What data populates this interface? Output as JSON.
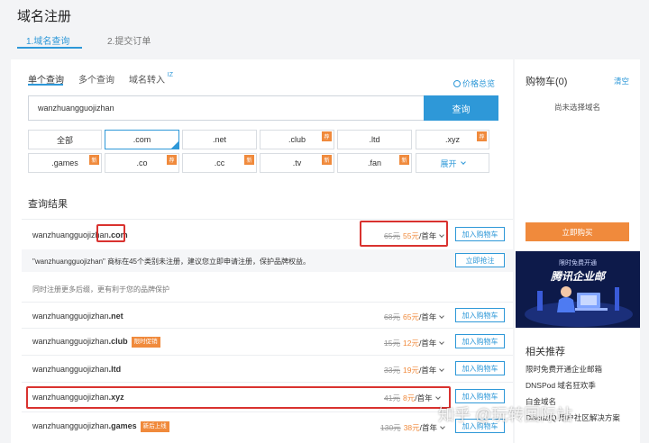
{
  "header": {
    "title": "域名注册",
    "steps": [
      "1.域名查询",
      "2.提交订单"
    ]
  },
  "search": {
    "tabs": [
      "单个查询",
      "多个查询",
      "域名转入"
    ],
    "transfer_mark": "IZ",
    "price_overview": "价格总览",
    "query": "wanzhuangguojizhan",
    "button": "查询"
  },
  "suffixes": [
    {
      "label": "全部",
      "badge": ""
    },
    {
      "label": ".com",
      "badge": ""
    },
    {
      "label": ".net",
      "badge": ""
    },
    {
      "label": ".club",
      "badge": "荐"
    },
    {
      "label": ".ltd",
      "badge": ""
    },
    {
      "label": ".xyz",
      "badge": "荐"
    },
    {
      "label": ".games",
      "badge": "新"
    },
    {
      "label": ".co",
      "badge": "荐"
    },
    {
      "label": ".cc",
      "badge": "新"
    },
    {
      "label": ".tv",
      "badge": "新"
    },
    {
      "label": ".fan",
      "badge": "新"
    },
    {
      "label": "展开",
      "badge": ""
    }
  ],
  "results": {
    "title": "查询结果",
    "base": "wanzhuangguojizhan",
    "rows": [
      {
        "tld": ".com",
        "promo": "",
        "old": "65元",
        "now": "55元",
        "unit": "/首年",
        "cart": "加入购物车"
      },
      {
        "tld": ".net",
        "promo": "",
        "old": "68元",
        "now": "65元",
        "unit": "/首年",
        "cart": "加入购物车"
      },
      {
        "tld": ".club",
        "promo": "限时促销",
        "old": "15元",
        "now": "12元",
        "unit": "/首年",
        "cart": "加入购物车"
      },
      {
        "tld": ".ltd",
        "promo": "",
        "old": "33元",
        "now": "19元",
        "unit": "/首年",
        "cart": "加入购物车"
      },
      {
        "tld": ".xyz",
        "promo": "",
        "old": "41元",
        "now": "8元",
        "unit": "/首年",
        "cart": "加入购物车"
      },
      {
        "tld": ".games",
        "promo": "新后上线",
        "old": "130元",
        "now": "38元",
        "unit": "/首年",
        "cart": "加入购物车"
      }
    ],
    "trademark_notice": "\"wanzhuangguojizhan\" 商标在45个类别未注册，建议您立即申请注册，保护品牌权益。",
    "trademark_button": "立即抢注",
    "hint": "同时注册更多后缀，更有利于您的品牌保护"
  },
  "cart": {
    "title": "购物车(0)",
    "clear": "清空",
    "empty": "尚未选择域名",
    "buy": "立即购买"
  },
  "banner": {
    "line1": "限时免费开通",
    "line2": "腾讯企业邮"
  },
  "recommend": {
    "title": "相关推荐",
    "items": [
      "限时免费开通企业邮箱",
      "DNSPod 域名狂欢季",
      "白金域名",
      "Discuz!Q 用户社区解决方案"
    ]
  },
  "watermark": "知乎 @玩转国际站",
  "colors": {
    "accent": "#2e98d8",
    "orange": "#f08a3c",
    "highlight": "#d9322f"
  }
}
